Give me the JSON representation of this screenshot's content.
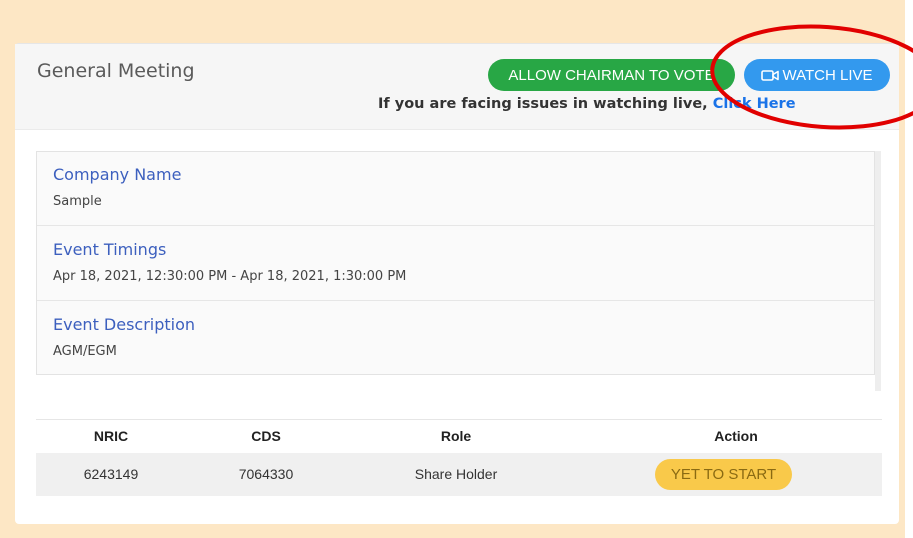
{
  "meeting": {
    "title": "General Meeting",
    "vote_button_label": "ALLOW CHAIRMAN TO VOTE",
    "watch_live_button_label": "WATCH LIVE",
    "issue_text": "If you are facing issues in watching live,",
    "issue_link_label": "Click Here"
  },
  "info": {
    "items": [
      {
        "label": "Company Name",
        "value": "Sample"
      },
      {
        "label": "Event Timings",
        "value": "Apr 18, 2021, 12:30:00 PM - Apr 18, 2021, 1:30:00 PM"
      },
      {
        "label": "Event Description",
        "value": "AGM/EGM"
      }
    ]
  },
  "table": {
    "headers": [
      "NRIC",
      "CDS",
      "Role",
      "Action"
    ],
    "rows": [
      {
        "nric": "6243149",
        "cds": "7064330",
        "role": "Share Holder",
        "action": "YET TO START"
      }
    ]
  },
  "icons": {
    "watch_live": "video-camera-icon"
  },
  "colors": {
    "background": "#fde7c5",
    "vote_button": "#28a745",
    "watch_button": "#3399ee",
    "label_blue": "#3c5fbe",
    "link_blue": "#1a73e8",
    "status_pill": "#f9c94a",
    "annotation_circle": "#e10000"
  }
}
